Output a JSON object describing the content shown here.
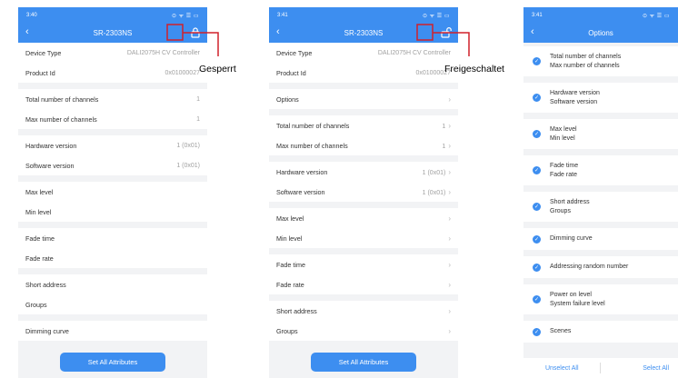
{
  "colors": {
    "accent": "#3d8ef0",
    "callout": "#d0202a",
    "background": "#f2f3f5"
  },
  "screens": {
    "locked": {
      "status": {
        "time": "3:40",
        "icons": "⊙ ᯤ ☰ ▭"
      },
      "title": "SR-2303NS",
      "lock_icon": "padlock-closed-icon",
      "device_type_label": "Device Type",
      "device_type_value": "DALI2075H CV Controller",
      "product_id_label": "Product Id",
      "product_id_value": "0x01000027",
      "total_channels_label": "Total number of channels",
      "total_channels_value": "1",
      "max_channels_label": "Max number of channels",
      "max_channels_value": "1",
      "hardware_label": "Hardware version",
      "hardware_value": "1 (0x01)",
      "software_label": "Software version",
      "software_value": "1 (0x01)",
      "max_level_label": "Max level",
      "min_level_label": "Min level",
      "fade_time_label": "Fade time",
      "fade_rate_label": "Fade rate",
      "short_address_label": "Short address",
      "groups_label": "Groups",
      "dimming_curve_label": "Dimming curve",
      "set_all_label": "Set All Attributes"
    },
    "unlocked": {
      "status": {
        "time": "3:41",
        "icons": "⊙ ᯤ ☰ ▭"
      },
      "title": "SR-2303NS",
      "lock_icon": "padlock-open-icon",
      "device_type_label": "Device Type",
      "device_type_value": "DALI2075H CV Controller",
      "product_id_label": "Product Id",
      "product_id_value": "0x01000027",
      "options_label": "Options",
      "total_channels_label": "Total number of channels",
      "total_channels_value": "1",
      "max_channels_label": "Max number of channels",
      "max_channels_value": "1",
      "hardware_label": "Hardware version",
      "hardware_value": "1 (0x01)",
      "software_label": "Software version",
      "software_value": "1 (0x01)",
      "max_level_label": "Max level",
      "min_level_label": "Min level",
      "fade_time_label": "Fade time",
      "fade_rate_label": "Fade rate",
      "short_address_label": "Short address",
      "groups_label": "Groups",
      "set_all_label": "Set All Attributes"
    },
    "options": {
      "status": {
        "time": "3:41",
        "icons": "⊙ ᯤ ☰ ▭"
      },
      "title": "Options",
      "items": [
        {
          "line1": "Total number of channels",
          "line2": "Max number of channels"
        },
        {
          "line1": "Hardware version",
          "line2": "Software version"
        },
        {
          "line1": "Max level",
          "line2": "Min level"
        },
        {
          "line1": "Fade time",
          "line2": "Fade rate"
        },
        {
          "line1": "Short address",
          "line2": "Groups"
        },
        {
          "line1": "Dimming curve",
          "line2": ""
        },
        {
          "line1": "Addressing random number",
          "line2": ""
        },
        {
          "line1": "Power on level",
          "line2": "System failure level"
        },
        {
          "line1": "Scenes",
          "line2": ""
        }
      ],
      "unselect_all_label": "Unselect All",
      "select_all_label": "Select All"
    }
  },
  "annotations": {
    "locked_label": "Gesperrt",
    "unlocked_label": "Freigeschaltet"
  }
}
